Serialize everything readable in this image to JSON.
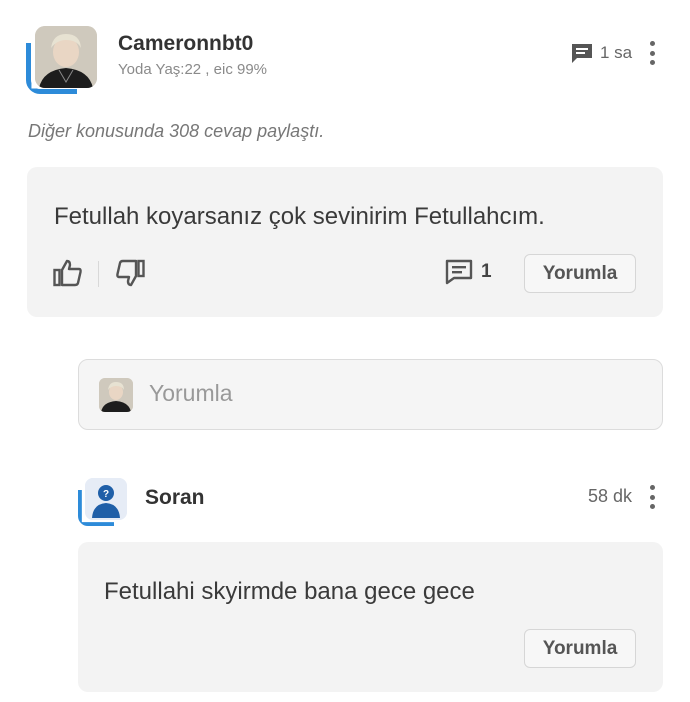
{
  "post": {
    "author_name": "Cameronnbt0",
    "author_meta": "Yoda Yaş:22 , eic 99%",
    "time": "1 sa",
    "activity": "Diğer konusunda 308 cevap paylaştı.",
    "text": "Fetullah koyarsanız çok sevinirim Fetullahcım.",
    "comment_count": "1",
    "reply_button": "Yorumla"
  },
  "comment_input": {
    "placeholder": "Yorumla"
  },
  "reply": {
    "author_name": "Soran",
    "time": "58 dk",
    "text": "Fetullahi skyirmde bana gece gece",
    "reply_button": "Yorumla"
  },
  "icons": {
    "comment": "comment-icon",
    "more": "more-vertical-icon",
    "like": "thumbs-up-icon",
    "dislike": "thumbs-down-icon"
  },
  "colors": {
    "accent": "#2d8bd9",
    "card_bg": "#f3f3f3"
  }
}
